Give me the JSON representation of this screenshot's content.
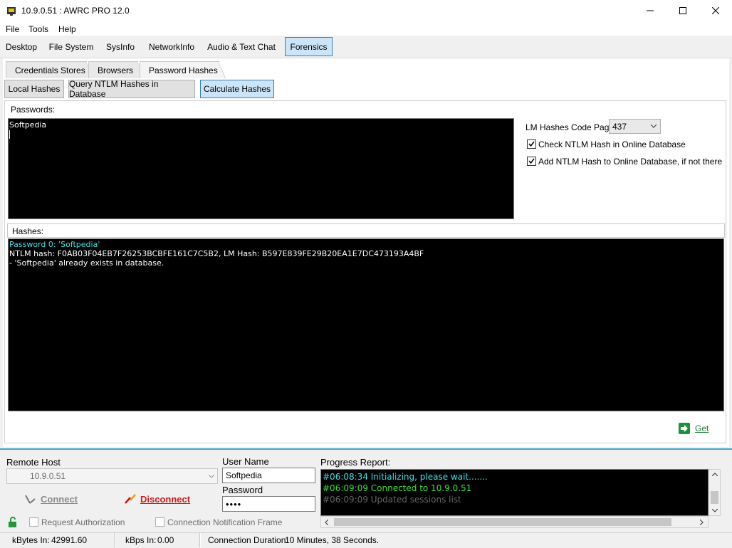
{
  "window": {
    "title": "10.9.0.51 : AWRC PRO 12.0"
  },
  "menu": [
    "File",
    "Tools",
    "Help"
  ],
  "main_tabs": [
    "Desktop",
    "File System",
    "SysInfo",
    "NetworkInfo",
    "Audio & Text Chat",
    "Forensics"
  ],
  "sub_tabs": [
    "Credentials Stores",
    "Browsers",
    "Password Hashes"
  ],
  "hash_tabs": [
    "Local Hashes",
    "Query NTLM Hashes in Database",
    "Calculate Hashes"
  ],
  "passwords": {
    "label": "Passwords:",
    "value": "Softpedia"
  },
  "options": {
    "code_page_label": "LM Hashes Code Page:",
    "code_page_value": "437",
    "check_online_label": "Check NTLM Hash in Online Database",
    "add_online_label": "Add NTLM Hash to Online Database, if not there"
  },
  "hashes": {
    "label": "Hashes:",
    "lines": [
      "Password 0: 'Softpedia'",
      "NTLM hash: F0AB03F04EB7F26253BCBFE161C7C5B2, LM Hash: B597E839FE29B20EA1E7DC473193A4BF",
      "- 'Softpedia' already exists in database."
    ]
  },
  "get_button": "Get",
  "connection": {
    "remote_host_label": "Remote Host",
    "remote_host_value": "10.9.0.51",
    "username_label": "User Name",
    "username_value": "Softpedia",
    "password_label": "Password",
    "password_value": "••••",
    "connect": "Connect",
    "disconnect": "Disconnect",
    "request_auth": "Request Authorization",
    "conn_notify": "Connection Notification Frame"
  },
  "progress": {
    "label": "Progress Report:",
    "lines": [
      "#06:08:34 Initializing, please wait.......",
      "#06:09:09 Connected to 10.9.0.51",
      "#06:09:09 Updated sessions list"
    ]
  },
  "status": {
    "kbytes_in_label": "kBytes In:",
    "kbytes_in_value": "42991.60",
    "kbps_in_label": "kBps In:",
    "kbps_in_value": "0.00",
    "duration_label": "Connection Duration:",
    "duration_value": "10 Minutes, 38 Seconds."
  },
  "colors": {
    "accent": "#cce4f7",
    "console_bg": "#000000",
    "cyan": "#40e0e8",
    "green": "#3ae03a",
    "disconnect": "#d21a1a"
  }
}
